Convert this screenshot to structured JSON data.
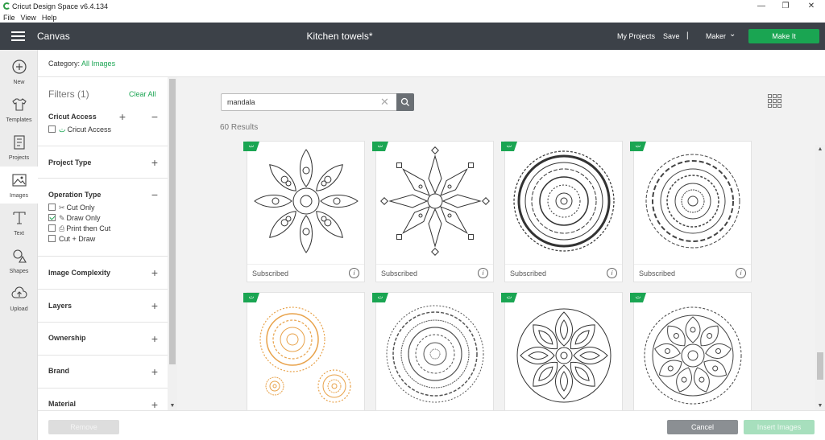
{
  "window": {
    "title": "Cricut Design Space  v6.4.134",
    "menu": [
      "File",
      "View",
      "Help"
    ],
    "controls": {
      "minimize": "—",
      "restore": "❐",
      "close": "✕"
    }
  },
  "header": {
    "canvas_label": "Canvas",
    "document_title": "Kitchen towels*",
    "my_projects": "My Projects",
    "save": "Save",
    "separator": "|",
    "machine": "Maker",
    "make_it": "Make It"
  },
  "rail": [
    {
      "label": "New",
      "icon": "plus-circle-icon"
    },
    {
      "label": "Templates",
      "icon": "shirt-icon"
    },
    {
      "label": "Projects",
      "icon": "projects-icon"
    },
    {
      "label": "Images",
      "icon": "image-icon",
      "active": true
    },
    {
      "label": "Text",
      "icon": "text-icon"
    },
    {
      "label": "Shapes",
      "icon": "shapes-icon"
    },
    {
      "label": "Upload",
      "icon": "upload-icon"
    }
  ],
  "category": {
    "prefix": "Category:",
    "value": "All Images"
  },
  "filters": {
    "heading": "Filters (1)",
    "clear_all": "Clear All",
    "cricut_access": {
      "title": "Cricut Access",
      "option": "Cricut Access"
    },
    "project_type": "Project Type",
    "operation_type": {
      "title": "Operation Type",
      "options": [
        {
          "label": "Cut Only",
          "checked": false
        },
        {
          "label": "Draw Only",
          "checked": true
        },
        {
          "label": "Print then Cut",
          "checked": false
        },
        {
          "label": "Cut + Draw",
          "checked": false
        }
      ]
    },
    "image_complexity": "Image Complexity",
    "layers": "Layers",
    "ownership": "Ownership",
    "brand": "Brand",
    "material": "Material"
  },
  "search": {
    "value": "mandala",
    "results": "60 Results"
  },
  "tiles": [
    {
      "status": "Subscribed"
    },
    {
      "status": "Subscribed"
    },
    {
      "status": "Subscribed"
    },
    {
      "status": "Subscribed"
    }
  ],
  "footer": {
    "remove": "Remove",
    "cancel": "Cancel",
    "insert": "Insert Images"
  },
  "colors": {
    "accent": "#1aa552",
    "header": "#3c4148",
    "mandala_orange": "#e8a24a"
  }
}
